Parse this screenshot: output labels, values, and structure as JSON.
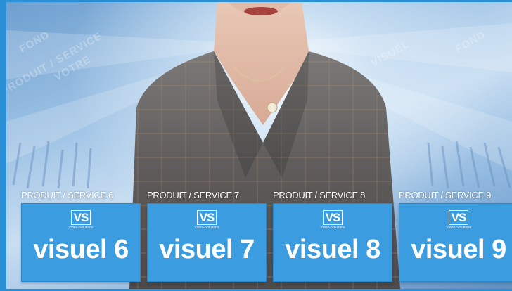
{
  "watermarks": [
    "PRODUIT / SERVICE",
    "VOTRE",
    "VISUEL",
    "FOND"
  ],
  "colors": {
    "accent": "#2b8fd6",
    "tile": "#3b9ce0"
  },
  "tiles": [
    {
      "caption": "PRODUIT / SERVICE 6",
      "logo_main": "VS",
      "logo_sub": "Vidéo-Solutions",
      "label": "visuel 6"
    },
    {
      "caption": "PRODUIT / SERVICE 7",
      "logo_main": "VS",
      "logo_sub": "Vidéo-Solutions",
      "label": "visuel 7"
    },
    {
      "caption": "PRODUIT / SERVICE 8",
      "logo_main": "VS",
      "logo_sub": "Vidéo-Solutions",
      "label": "visuel 8"
    },
    {
      "caption": "PRODUIT / SERVICE 9",
      "logo_main": "VS",
      "logo_sub": "Vidéo-Solutions",
      "label": "visuel 9"
    }
  ]
}
